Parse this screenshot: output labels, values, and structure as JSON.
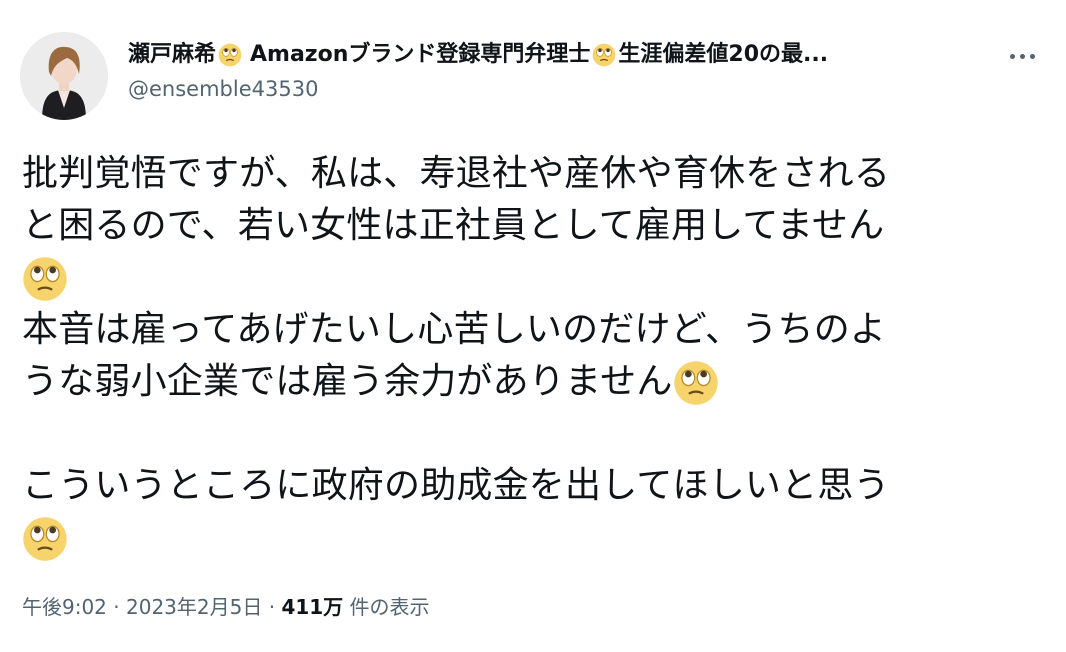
{
  "author": {
    "name_part1": "瀬戸麻希",
    "name_part2": "Amazonブランド登録専門弁理士",
    "name_part3": "生涯偏差値20の最...",
    "handle": "@ensemble43530"
  },
  "emoji": "face-with-rolling-eyes",
  "tweet": {
    "line1": "批判覚悟ですが、私は、寿退社や産休や育休をされる",
    "line2": "と困るので、若い女性は正社員として雇用してません",
    "line4": "本音は雇ってあげたいし心苦しいのだけど、うちのよ",
    "line5": "うな弱小企業では雇う余力がありません",
    "line7": "こういうところに政府の助成金を出してほしいと思う"
  },
  "meta": {
    "time": "午後9:02",
    "sep1": " · ",
    "date": "2023年2月5日",
    "sep2": " · ",
    "views_count": "411万",
    "views_label": " 件の表示"
  }
}
